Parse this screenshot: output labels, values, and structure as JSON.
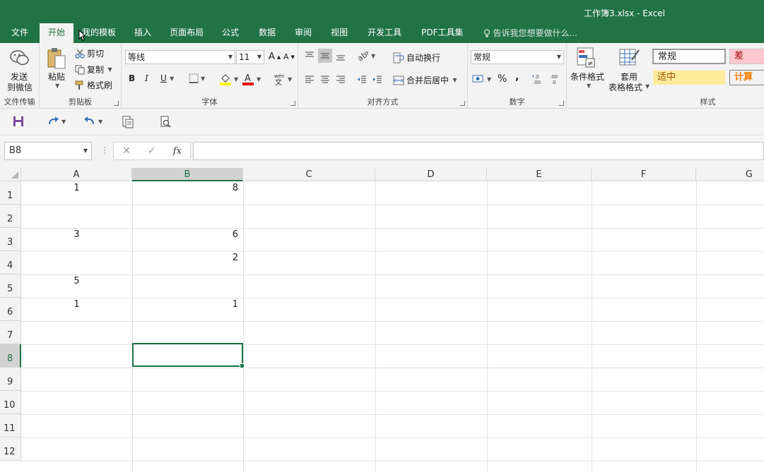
{
  "window": {
    "title": "工作簿3.xlsx - Excel"
  },
  "tabs": [
    {
      "label": "文件"
    },
    {
      "label": "开始"
    },
    {
      "label": "我的模板"
    },
    {
      "label": "插入"
    },
    {
      "label": "页面布局"
    },
    {
      "label": "公式"
    },
    {
      "label": "数据"
    },
    {
      "label": "审阅"
    },
    {
      "label": "视图"
    },
    {
      "label": "开发工具"
    },
    {
      "label": "PDF工具集"
    }
  ],
  "tell_me": "告诉我您想要做什么...",
  "ribbon": {
    "wechat": {
      "line1": "发送",
      "line2": "到微信",
      "group": "文件传输"
    },
    "clipboard": {
      "paste": "粘贴",
      "cut": "剪切",
      "copy": "复制",
      "format_painter": "格式刷",
      "group": "剪贴板"
    },
    "font": {
      "name": "等线",
      "size": "11",
      "bold": "B",
      "italic": "I",
      "underline": "U",
      "group": "字体"
    },
    "alignment": {
      "wrap": "自动换行",
      "merge": "合并后居中",
      "group": "对齐方式"
    },
    "number": {
      "format": "常规",
      "percent": "%",
      "comma": ",",
      "group": "数字"
    },
    "styles": {
      "conditional": "条件格式",
      "table_line1": "套用",
      "table_line2": "表格格式",
      "normal": "常规",
      "bad": "差",
      "neutral": "适中",
      "calc": "计算",
      "group": "样式"
    }
  },
  "formula_bar": {
    "name_box": "B8",
    "value": ""
  },
  "columns": [
    "A",
    "B",
    "C",
    "D",
    "E",
    "F",
    "G"
  ],
  "rows": [
    "1",
    "2",
    "3",
    "4",
    "5",
    "6",
    "7",
    "8",
    "9",
    "10",
    "11",
    "12"
  ],
  "cells": {
    "A1": "1",
    "B1": "8",
    "A3": "3",
    "B3": "6",
    "B4": "2",
    "A5": "5",
    "A6": "1",
    "B6": "1"
  },
  "colors": {
    "accent": "#217346",
    "bad_bg": "#ffc7ce",
    "bad_fg": "#9c0006",
    "neutral_bg": "#ffeb9c",
    "neutral_fg": "#9c5700",
    "calc_fg": "#fa7d00"
  }
}
